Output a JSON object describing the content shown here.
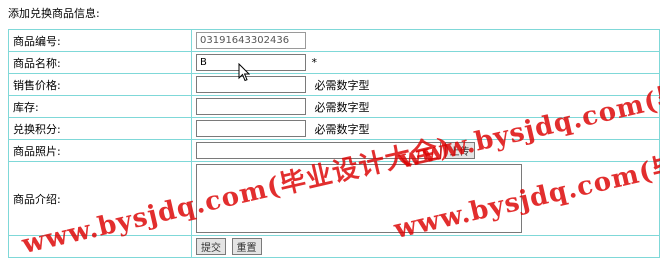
{
  "page": {
    "title": "添加兑换商品信息:"
  },
  "form": {
    "code": {
      "label": "商品编号:",
      "value": "03191643302436"
    },
    "name": {
      "label": "商品名称:",
      "value": "B",
      "required_mark": "*"
    },
    "price": {
      "label": "销售价格:",
      "value": "",
      "note": "必需数字型"
    },
    "stock": {
      "label": "库存:",
      "value": "",
      "note": "必需数字型"
    },
    "points": {
      "label": "兑换积分:",
      "value": "",
      "note": "必需数字型"
    },
    "photo": {
      "label": "商品照片:",
      "value": "",
      "upload_label": "上传"
    },
    "intro": {
      "label": "商品介绍:",
      "value": ""
    },
    "actions": {
      "submit_label": "提交",
      "reset_label": "重置"
    }
  },
  "watermarks": [
    "www.bysjdq.com(毕业设计大全)",
    "www.bysjdq.com(毕业设计大全)",
    "www.bysjdq.com(毕业设计大全)"
  ]
}
